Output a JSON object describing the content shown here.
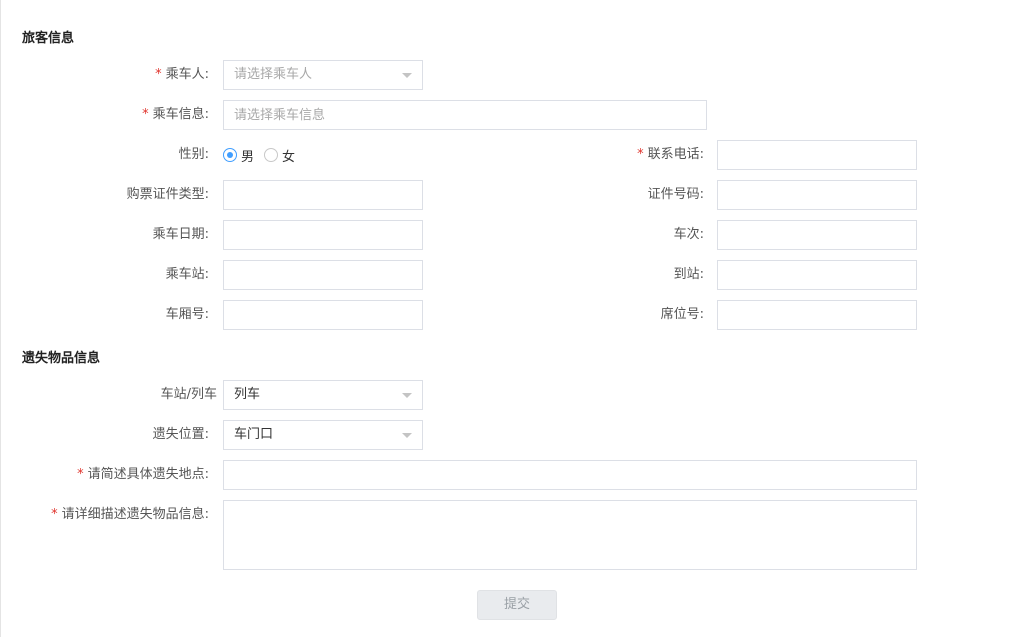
{
  "passenger": {
    "title": "旅客信息",
    "rider_label": "乘车人:",
    "rider_placeholder": "请选择乘车人",
    "trip_info_label": "乘车信息:",
    "trip_info_placeholder": "请选择乘车信息",
    "gender_label": "性别:",
    "gender_male": "男",
    "gender_female": "女",
    "phone_label": "联系电话:",
    "id_type_label": "购票证件类型:",
    "id_number_label": "证件号码:",
    "date_label": "乘车日期:",
    "train_no_label": "车次:",
    "depart_station_label": "乘车站:",
    "arrive_station_label": "到站:",
    "car_no_label": "车厢号:",
    "seat_no_label": "席位号:"
  },
  "lost_item": {
    "title": "遗失物品信息",
    "place_type_label": "车站/列车",
    "place_type_value": "列车",
    "position_label": "遗失位置:",
    "position_value": "车门口",
    "location_desc_label": "请简述具体遗失地点:",
    "item_desc_label": "请详细描述遗失物品信息:"
  },
  "actions": {
    "submit_label": "提交"
  },
  "colors": {
    "required": "#e0322b",
    "radio_checked": "#409eff"
  }
}
